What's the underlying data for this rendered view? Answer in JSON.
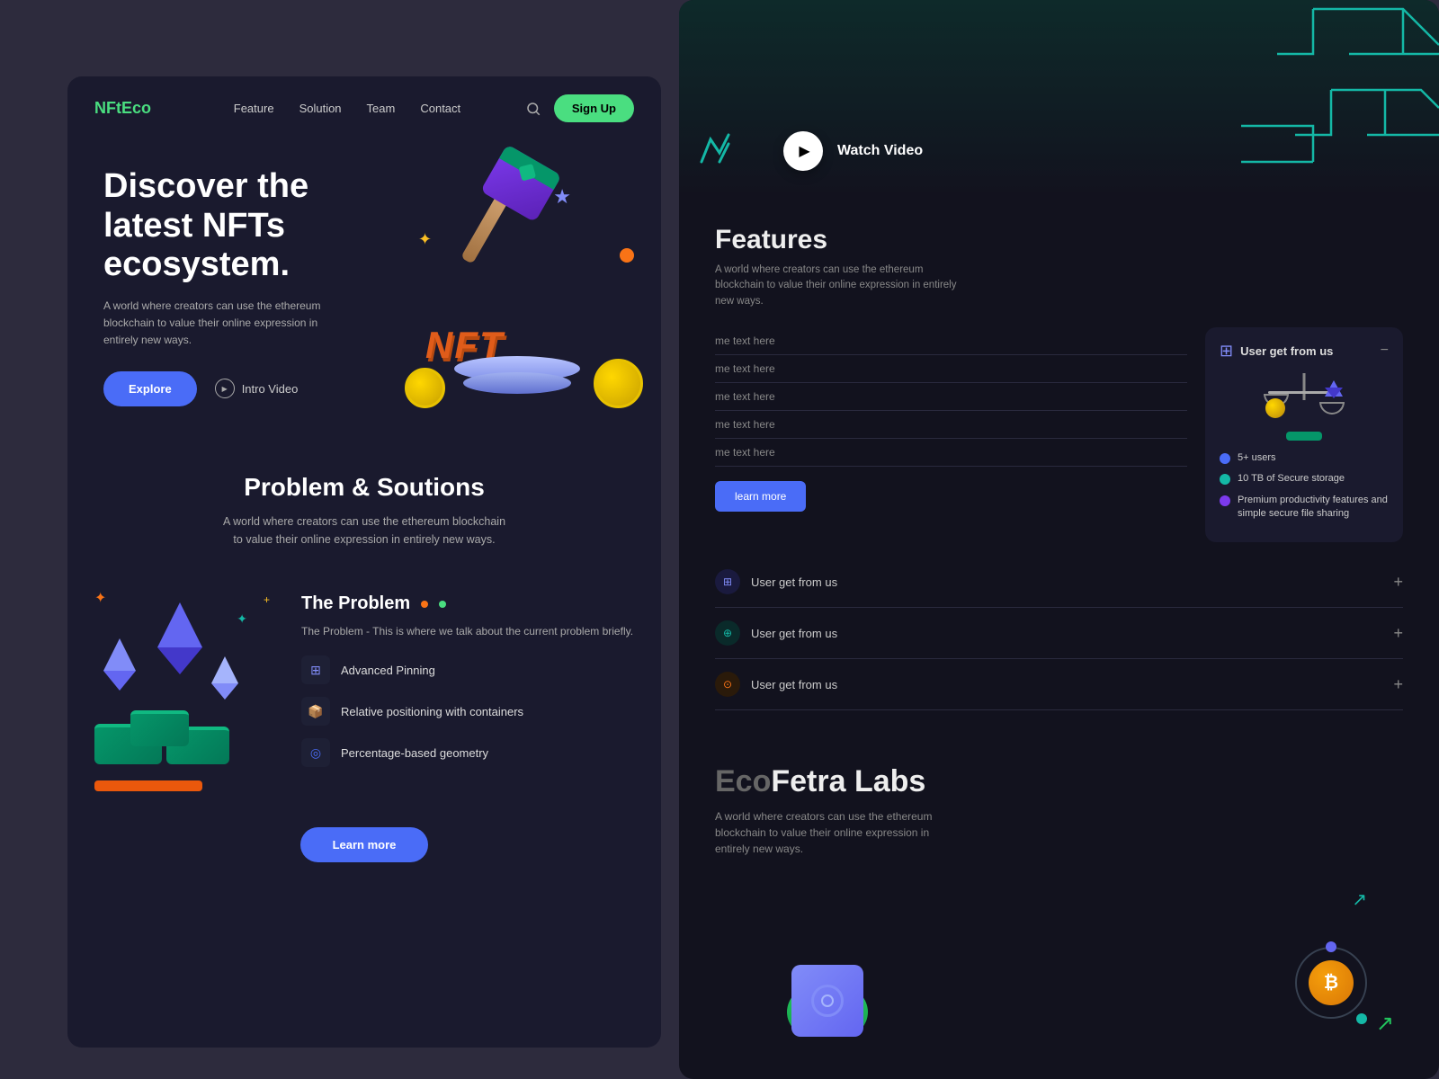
{
  "left_panel": {
    "nav": {
      "logo_prefix": "NFt",
      "logo_suffix": "Eco",
      "links": [
        "Feature",
        "Solution",
        "Team",
        "Contact"
      ],
      "signup_label": "Sign Up"
    },
    "hero": {
      "title": "Discover the latest NFTs ecosystem.",
      "description": "A world where creators can use the ethereum blockchain to value their online expression in entirely new ways.",
      "explore_label": "Explore",
      "intro_video_label": "Intro Video"
    },
    "problems_section": {
      "title": "Problem & Soutions",
      "description": "A world where creators can use the ethereum blockchain to value their online expression in entirely new ways.",
      "problem_title": "The Problem",
      "problem_brief": "The Problem - This is where we talk about the current problem briefly.",
      "features": [
        {
          "icon": "⊞",
          "label": "Advanced Pinning"
        },
        {
          "icon": "📦",
          "label": "Relative positioning with containers"
        },
        {
          "icon": "◎",
          "label": "Percentage-based geometry"
        }
      ],
      "learn_more_label": "Learn more"
    }
  },
  "right_panel": {
    "watch_video": {
      "label": "Watch Video"
    },
    "features": {
      "title": "Features",
      "description": "A world where creators can use the ethereum blockchain to value their online expression in entirely new ways.",
      "list_items": [
        "me text here",
        "me text here",
        "me text here",
        "me text here",
        "me text here"
      ],
      "learn_more_label": "learn more",
      "card": {
        "title": "User get from us",
        "features": [
          {
            "color": "blue",
            "text": "5+ users"
          },
          {
            "color": "teal",
            "text": "10 TB of Secure storage"
          },
          {
            "color": "purple",
            "text": "Premium productivity features and simple secure file sharing"
          }
        ]
      },
      "accordion": [
        {
          "icon": "⊞",
          "color": "#818cf8",
          "label": "User get from us"
        },
        {
          "icon": "⊕",
          "color": "#14b8a6",
          "label": "User get from us"
        },
        {
          "icon": "⊙",
          "color": "#f97316",
          "label": "User get from us"
        }
      ]
    },
    "ecofetra": {
      "title_grey": "Eco",
      "title_white": "Fetra Labs",
      "description": "A world where creators can use the ethereum blockchain to value their online expression in entirely new ways."
    }
  }
}
